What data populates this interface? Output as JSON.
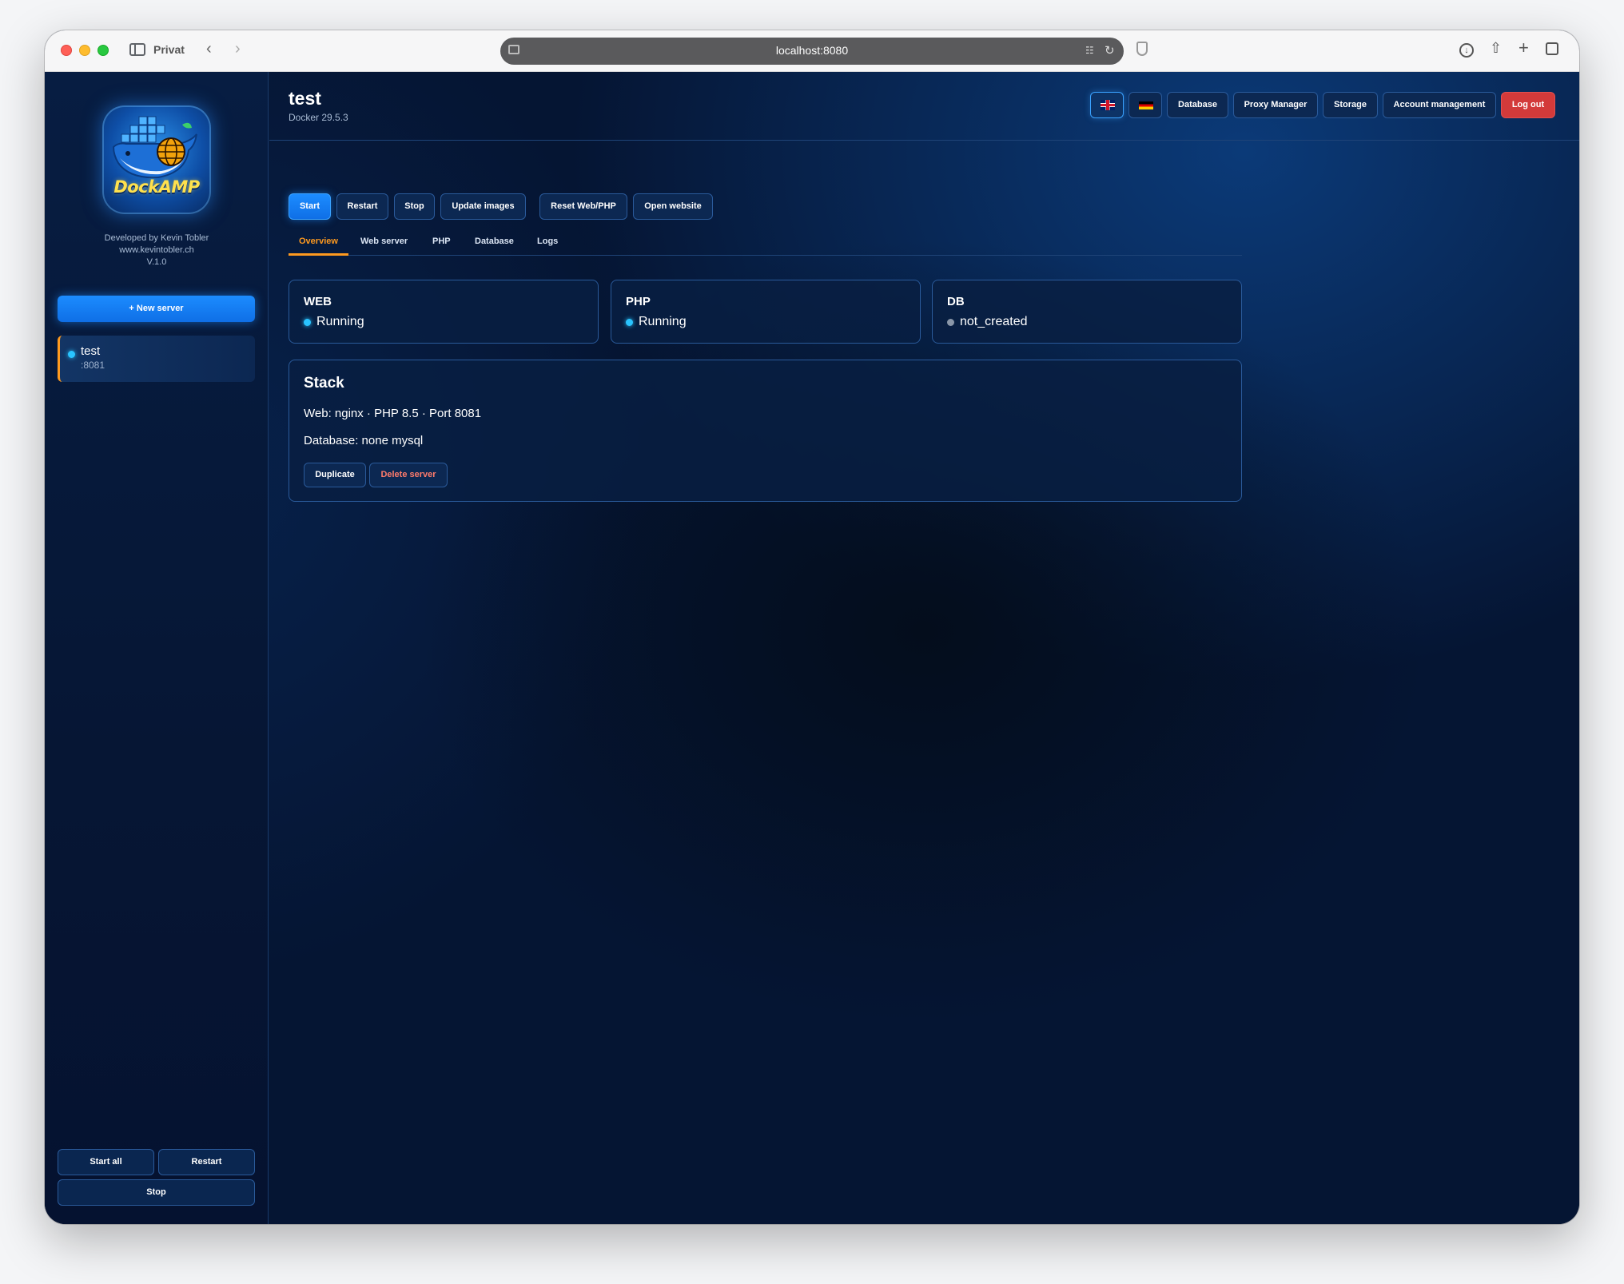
{
  "browser": {
    "private_label": "Privat",
    "url": "localhost:8080"
  },
  "sidebar": {
    "logo_text": "DockAMP",
    "credit_line1": "Developed by Kevin Tobler",
    "credit_line2": "www.kevintobler.ch",
    "version": "V.1.0",
    "new_server_label": "+ New server",
    "servers": [
      {
        "name": "test",
        "port": ":8081",
        "status": "running"
      }
    ],
    "start_all_label": "Start all",
    "restart_label": "Restart",
    "stop_label": "Stop"
  },
  "header": {
    "title": "test",
    "docker_version": "Docker 29.5.3",
    "buttons": {
      "database": "Database",
      "proxy_manager": "Proxy Manager",
      "storage": "Storage",
      "account_management": "Account management",
      "log_out": "Log out"
    }
  },
  "actions": {
    "start": "Start",
    "restart": "Restart",
    "stop": "Stop",
    "update_images": "Update images",
    "reset_web_php": "Reset Web/PHP",
    "open_website": "Open website"
  },
  "tabs": [
    "Overview",
    "Web server",
    "PHP",
    "Database",
    "Logs"
  ],
  "status_cards": [
    {
      "label": "WEB",
      "status": "Running"
    },
    {
      "label": "PHP",
      "status": "Running"
    },
    {
      "label": "DB",
      "status": "not_created"
    }
  ],
  "stack": {
    "title": "Stack",
    "web_line": "Web: nginx · PHP 8.5 · Port 8081",
    "db_line": "Database: none mysql",
    "duplicate_label": "Duplicate",
    "delete_label": "Delete server"
  },
  "colors": {
    "accent": "#1c8cff",
    "active_tab": "#ff9a1f",
    "running_dot": "#29c4ff",
    "danger": "#d33a3a"
  }
}
